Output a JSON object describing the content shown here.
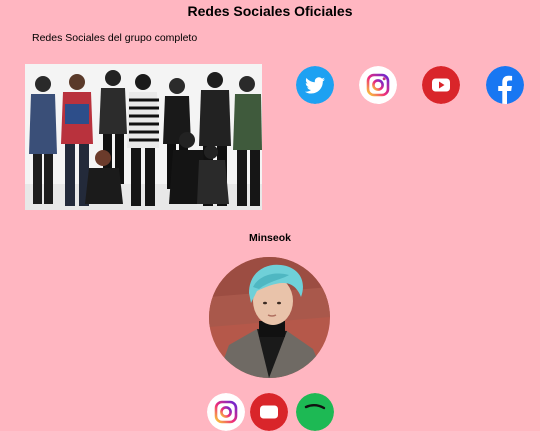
{
  "page": {
    "title": "Redes Sociales Oficiales"
  },
  "group": {
    "label": "Redes Sociales del grupo completo",
    "photo": {
      "alt": ""
    },
    "socials": [
      {
        "icon": "twitter-icon",
        "color": "#1da1f2"
      },
      {
        "icon": "instagram-icon",
        "color": "#d62976"
      },
      {
        "icon": "youtube-icon",
        "color": "#d9252a"
      },
      {
        "icon": "facebook-icon",
        "color": "#1877f2"
      }
    ]
  },
  "members": [
    {
      "name": "Minseok",
      "photo": {
        "alt": ""
      },
      "socials": [
        {
          "icon": "instagram-icon",
          "color": "#d62976"
        },
        {
          "icon": "youtube-icon",
          "color": "#d9252a"
        },
        {
          "icon": "spotify-icon",
          "color": "#1db954"
        }
      ]
    }
  ]
}
